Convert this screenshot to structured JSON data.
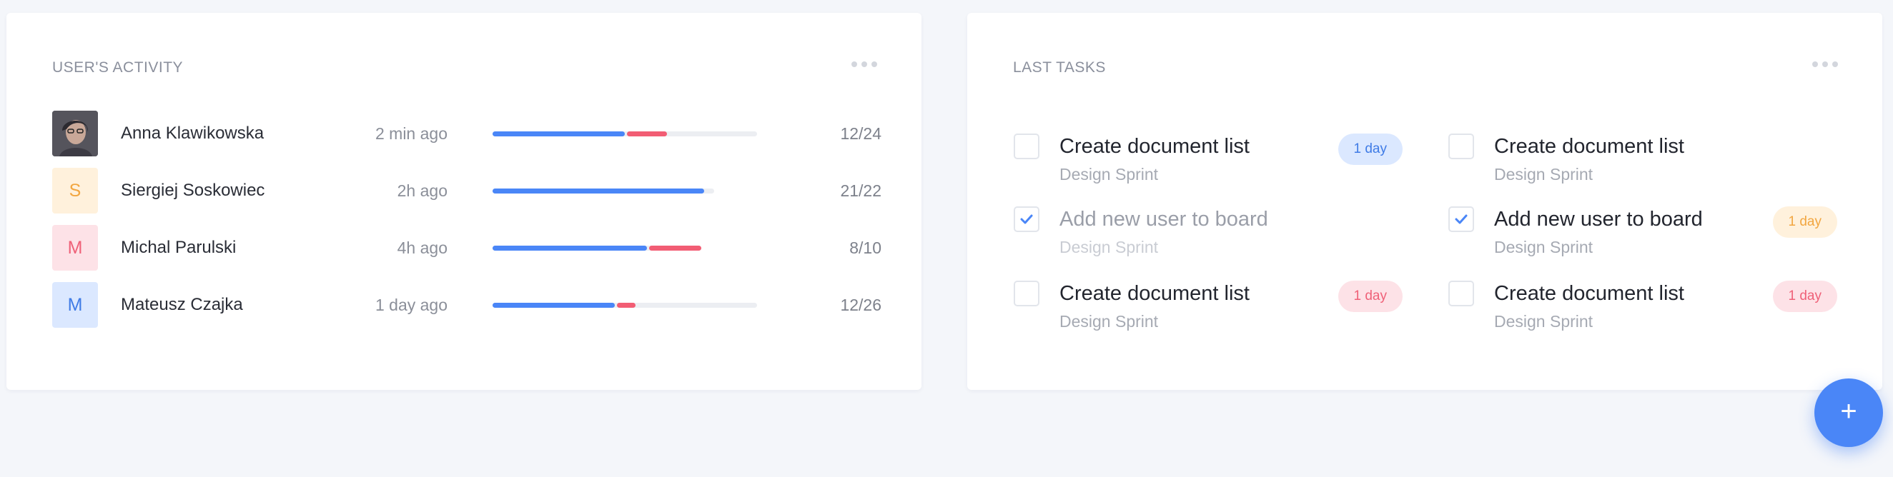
{
  "activity": {
    "title": "USER'S ACTIVITY",
    "users": [
      {
        "name": "Anna Klawikowska",
        "time": "2 min ago",
        "count": "12/24",
        "initial": "",
        "avatar_type": "photo",
        "progress": {
          "total": 24,
          "completed": 12,
          "in_progress": 4
        }
      },
      {
        "name": "Siergiej Soskowiec",
        "time": "2h ago",
        "count": "21/22",
        "initial": "S",
        "avatar_type": "initial",
        "avatar_bg": "#fff1dc",
        "avatar_fg": "#f2a640",
        "progress": {
          "total": 22,
          "completed": 21,
          "in_progress": 0
        }
      },
      {
        "name": "Michal Parulski",
        "time": "4h ago",
        "count": "8/10",
        "initial": "M",
        "avatar_type": "initial",
        "avatar_bg": "#fde2e7",
        "avatar_fg": "#ef6178",
        "progress": {
          "total": 10,
          "completed": 8,
          "in_progress": 3
        }
      },
      {
        "name": "Mateusz Czajka",
        "time": "1 day ago",
        "count": "12/26",
        "initial": "M",
        "avatar_type": "initial",
        "avatar_bg": "#dbe8ff",
        "avatar_fg": "#3f7be6",
        "progress": {
          "total": 26,
          "completed": 12,
          "in_progress": 2
        }
      }
    ]
  },
  "tasks": {
    "title": "LAST TASKS",
    "columns": [
      [
        {
          "title": "Create document list",
          "project": "Design Sprint",
          "checked": false,
          "badge": "1 day",
          "badge_color": "blue"
        },
        {
          "title": "Add new user to board",
          "project": "Design Sprint",
          "checked": true,
          "badge": "",
          "badge_color": ""
        },
        {
          "title": "Create document list",
          "project": "Design Sprint",
          "checked": false,
          "badge": "1 day",
          "badge_color": "pink"
        }
      ],
      [
        {
          "title": "Create document list",
          "project": "Design Sprint",
          "checked": false,
          "badge": "",
          "badge_color": ""
        },
        {
          "title": "Add new user to board",
          "project": "Design Sprint",
          "checked": true,
          "badge": "1 day",
          "badge_color": "orange"
        },
        {
          "title": "Create document list",
          "project": "Design Sprint",
          "checked": false,
          "badge": "1 day",
          "badge_color": "pink"
        }
      ]
    ]
  },
  "fab": {
    "label": "+"
  },
  "colors": {
    "accent": "#4a86f7",
    "danger": "#f25d74",
    "background": "#f4f6fa"
  },
  "icons": {
    "menu": "more-horizontal-icon",
    "check": "check-icon",
    "add": "plus-icon"
  }
}
